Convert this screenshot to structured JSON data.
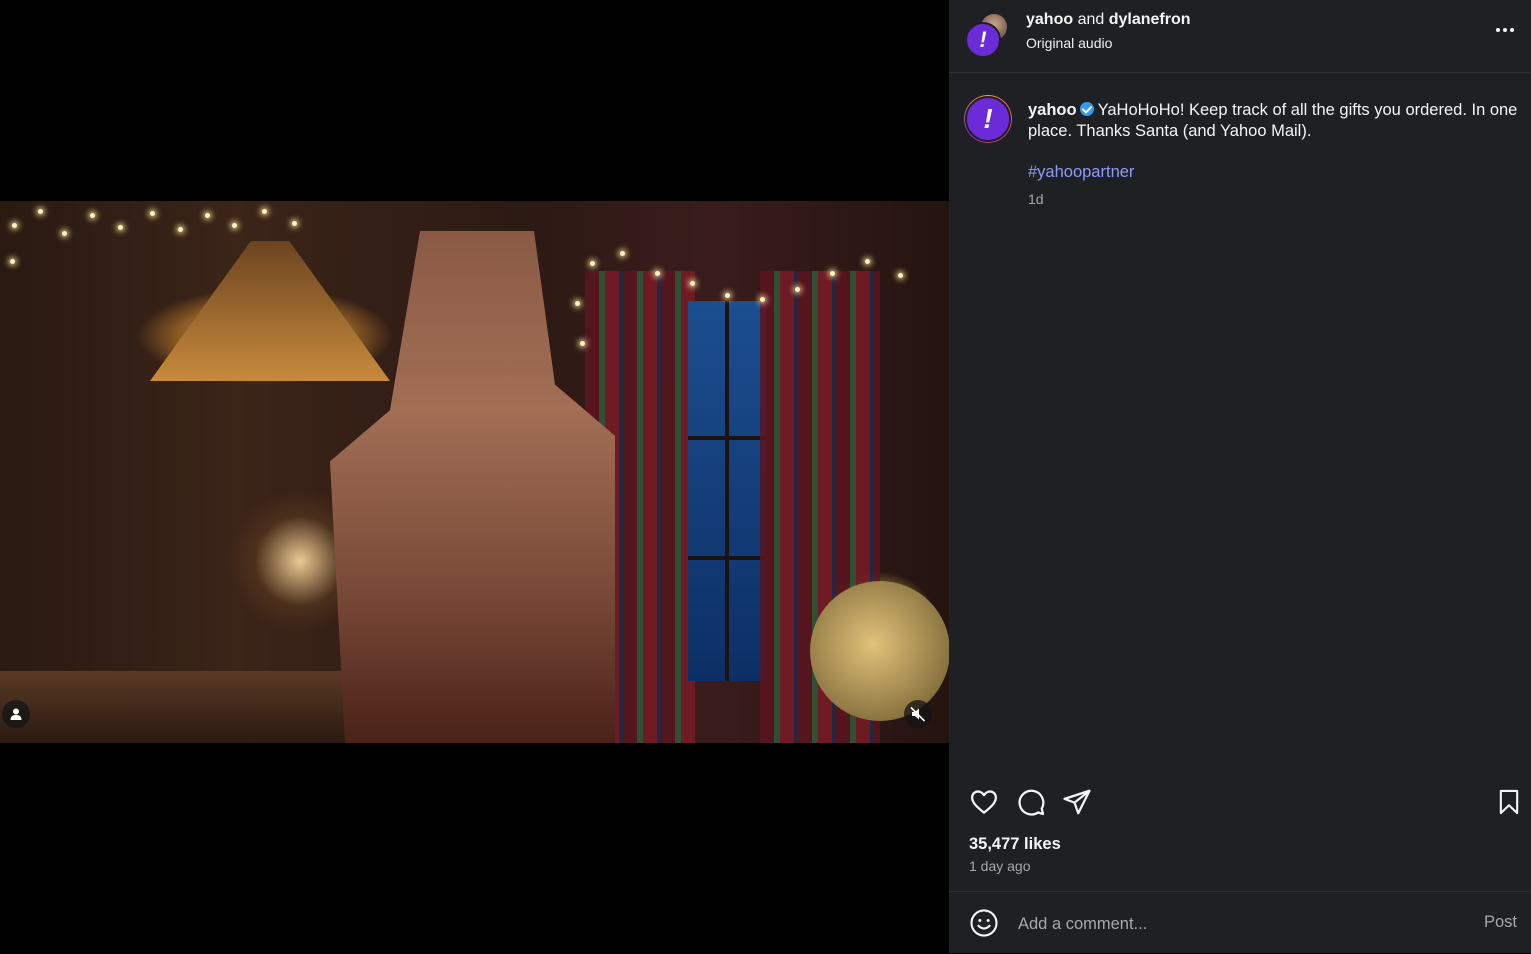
{
  "header": {
    "user1": "yahoo",
    "conjunction": "and",
    "user2": "dylanefron",
    "audio": "Original audio"
  },
  "post": {
    "username": "yahoo",
    "caption": "YaHoHoHo! Keep track of all the gifts you ordered. In one place. Thanks Santa (and Yahoo Mail).",
    "hashtag": "#yahoopartner",
    "time_short": "1d"
  },
  "stats": {
    "likes": "35,477 likes",
    "time_ago": "1 day ago"
  },
  "comment": {
    "placeholder": "Add a comment...",
    "post_label": "Post"
  },
  "icons": {
    "avatar_glyph": "!",
    "colors": {
      "yahoo_purple": "#6b2bd9",
      "verified_blue": "#3897f0",
      "hashtag": "#8c9cf5",
      "panel_bg": "#1f2024"
    }
  }
}
